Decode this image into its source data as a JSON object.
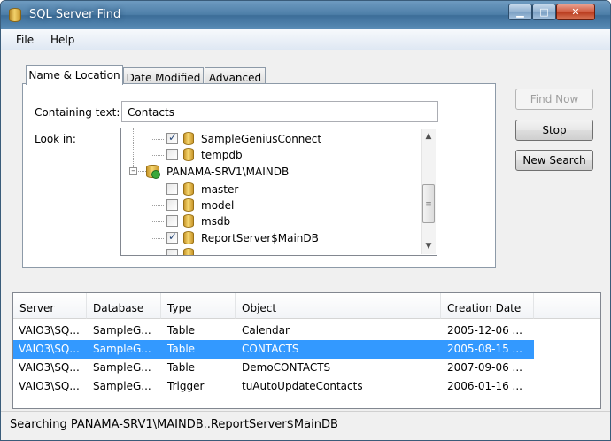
{
  "window": {
    "title": "SQL Server Find",
    "min": "▁",
    "max": "□",
    "close": "✕"
  },
  "menu": [
    "File",
    "Help"
  ],
  "tabs": [
    "Name & Location",
    "Date Modified",
    "Advanced"
  ],
  "form": {
    "containing_label": "Containing text:",
    "containing_value": "Contacts",
    "lookin_label": "Look in:"
  },
  "tree": [
    {
      "label": "SampleGeniusConnect",
      "checked": true
    },
    {
      "label": "tempdb",
      "checked": false
    },
    {
      "label": "PANAMA-SRV1\\MAINDB",
      "server": true
    },
    {
      "label": "master",
      "checked": false
    },
    {
      "label": "model",
      "checked": false
    },
    {
      "label": "msdb",
      "checked": false
    },
    {
      "label": "ReportServer$MainDB",
      "checked": true
    }
  ],
  "buttons": {
    "find": "Find Now",
    "stop": "Stop",
    "new": "New Search"
  },
  "results": {
    "columns": [
      "Server",
      "Database",
      "Type",
      "Object",
      "Creation Date"
    ],
    "rows": [
      [
        "VAIO3\\SQ...",
        "SampleG...",
        "Table",
        "Calendar",
        "2005-12-06 ..."
      ],
      [
        "VAIO3\\SQ...",
        "SampleG...",
        "Table",
        "CONTACTS",
        "2005-08-15 ..."
      ],
      [
        "VAIO3\\SQ...",
        "SampleG...",
        "Table",
        "DemoCONTACTS",
        "2007-09-06 ..."
      ],
      [
        "VAIO3\\SQ...",
        "SampleG...",
        "Trigger",
        "tuAutoUpdateContacts",
        "2006-01-16 ..."
      ]
    ],
    "selected_row": 1
  },
  "status": "Searching PANAMA-SRV1\\MAINDB..ReportServer$MainDB"
}
